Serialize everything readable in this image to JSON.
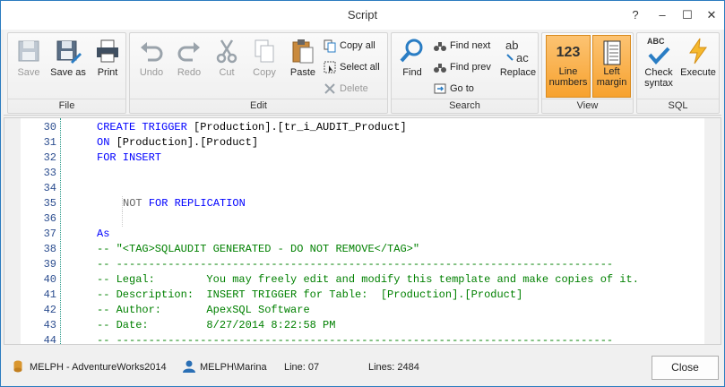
{
  "window": {
    "title": "Script",
    "help": "?",
    "minimize": "–",
    "maximize": "☐",
    "close": "✕"
  },
  "ribbon": {
    "file": {
      "label": "File",
      "save": "Save",
      "save_as": "Save as",
      "print": "Print"
    },
    "edit": {
      "label": "Edit",
      "undo": "Undo",
      "redo": "Redo",
      "cut": "Cut",
      "copy": "Copy",
      "paste": "Paste",
      "copy_all": "Copy all",
      "select_all": "Select all",
      "delete": "Delete"
    },
    "search": {
      "label": "Search",
      "find": "Find",
      "find_next": "Find next",
      "find_prev": "Find prev",
      "go_to": "Go to",
      "replace": "Replace"
    },
    "view": {
      "label": "View",
      "line_numbers_1": "Line",
      "line_numbers_2": "numbers",
      "line_numbers_icon": "123",
      "left_margin_1": "Left",
      "left_margin_2": "margin"
    },
    "sql": {
      "label": "SQL",
      "check_syntax_1": "Check",
      "check_syntax_2": "syntax",
      "check_icon": "ABC",
      "execute": "Execute"
    }
  },
  "editor": {
    "lines": [
      {
        "num": "30",
        "a": "CREATE TRIGGER ",
        "b": "[Production].[tr_i_AUDIT_Product]"
      },
      {
        "num": "31",
        "a": "ON ",
        "b": "[Production].[Product]"
      },
      {
        "num": "32",
        "a": "FOR INSERT",
        "b": ""
      },
      {
        "num": "33",
        "a": "",
        "b": ""
      },
      {
        "num": "34",
        "a": "",
        "b": ""
      },
      {
        "num": "35",
        "a": "NOT ",
        "b": "FOR REPLICATION"
      },
      {
        "num": "36",
        "a": "",
        "b": ""
      },
      {
        "num": "37",
        "a": "As",
        "b": ""
      },
      {
        "num": "38",
        "a": "-- \"<TAG>SQLAUDIT GENERATED - DO NOT REMOVE</TAG>\"",
        "b": ""
      },
      {
        "num": "39",
        "a": "-- -----------------------------------------------------------------------------",
        "b": ""
      },
      {
        "num": "40",
        "a": "-- Legal:        You may freely edit and modify this template and make copies of it.",
        "b": ""
      },
      {
        "num": "41",
        "a": "-- Description:  INSERT TRIGGER for Table:  [Production].[Product]",
        "b": ""
      },
      {
        "num": "42",
        "a": "-- Author:       ApexSQL Software",
        "b": ""
      },
      {
        "num": "43",
        "a": "-- Date:         8/27/2014 8:22:58 PM",
        "b": ""
      },
      {
        "num": "44",
        "a": "-- -----------------------------------------------------------------------------",
        "b": ""
      }
    ]
  },
  "status": {
    "server": "MELPH - AdventureWorks2014",
    "user": "MELPH\\Marina",
    "line": "Line: 07",
    "lines": "Lines: 2484",
    "close": "Close"
  },
  "colors": {
    "keyword": "#0000ff",
    "comment": "#008000",
    "toggle_active": "#f7a22f"
  }
}
